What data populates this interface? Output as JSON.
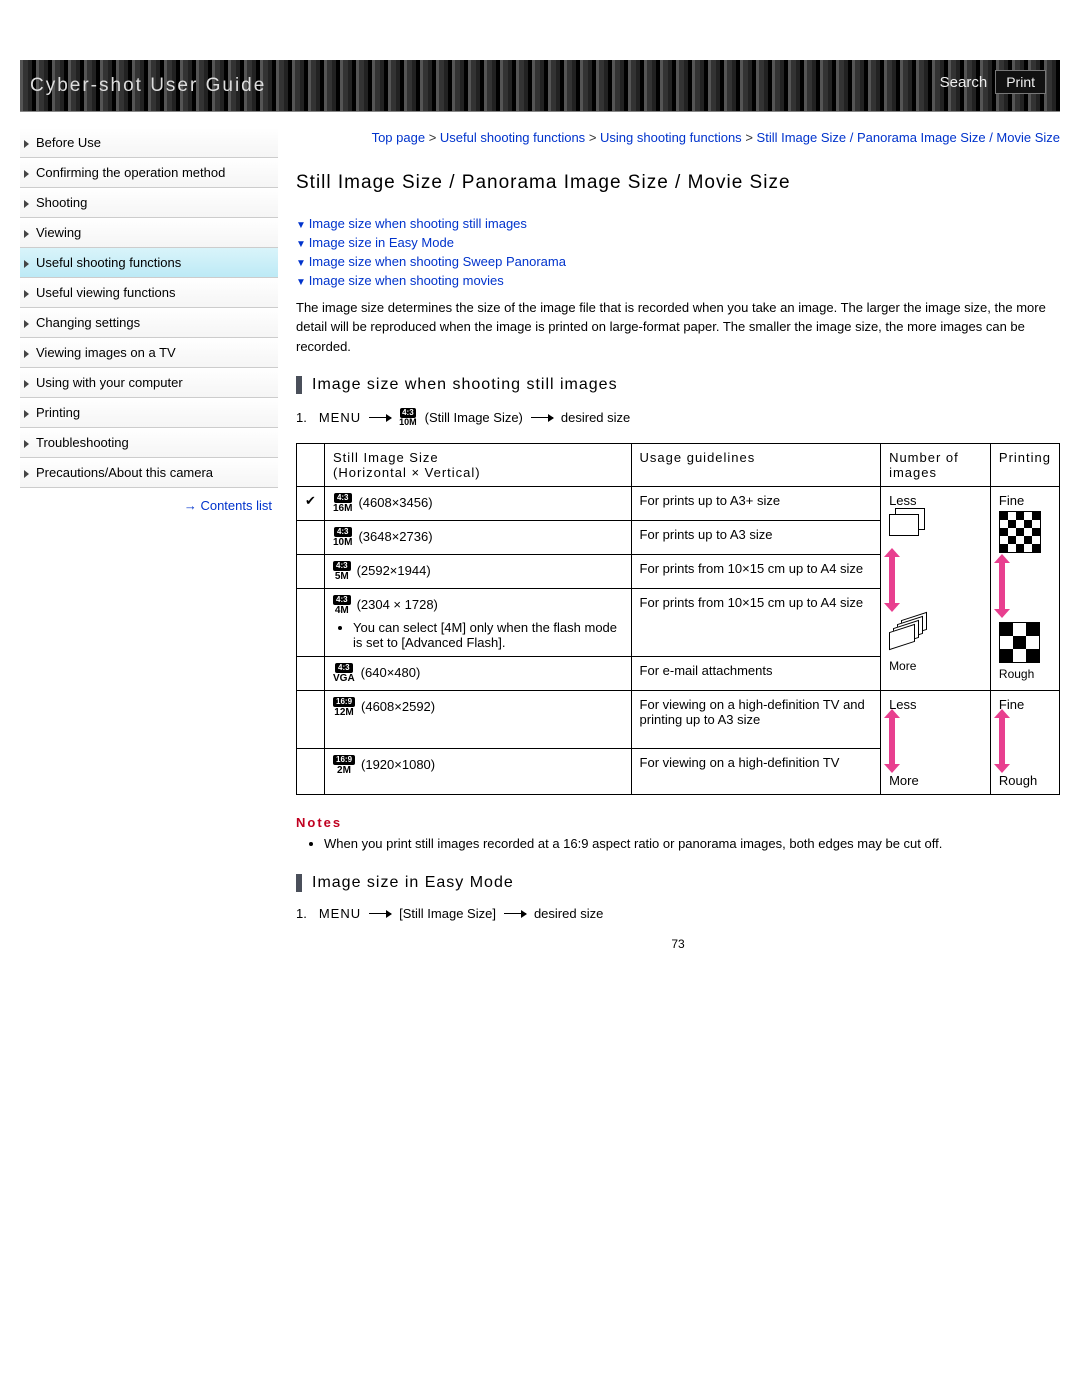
{
  "header": {
    "title": "Cyber-shot User Guide",
    "search": "Search",
    "print": "Print"
  },
  "breadcrumbs": {
    "seg1": "Top page",
    "sep": " > ",
    "seg2": "Useful shooting functions",
    "seg3": "Using shooting functions",
    "seg4": "Still Image Size / Panorama Image Size / Movie Size"
  },
  "sidebar": {
    "items": [
      "Before Use",
      "Confirming the operation method",
      "Shooting",
      "Viewing",
      "Useful shooting functions",
      "Useful viewing functions",
      "Changing settings",
      "Viewing images on a TV",
      "Using with your computer",
      "Printing",
      "Troubleshooting",
      "Precautions/About this camera"
    ],
    "contents": "Contents list"
  },
  "title": "Still Image Size / Panorama Image Size / Movie Size",
  "anchors": [
    "Image size when shooting still images",
    "Image size in Easy Mode",
    "Image size when shooting Sweep Panorama",
    "Image size when shooting movies"
  ],
  "intro": "The image size determines the size of the image file that is recorded when you take an image. The larger the image size, the more detail will be reproduced when the image is printed on large-format paper. The smaller the image size, the more images can be recorded.",
  "sec1": {
    "heading": "Image size when shooting still images",
    "menu": "MENU",
    "badge_ratio": "4:3",
    "badge_mp": "10M",
    "still_label": "(Still Image Size)",
    "desired": "desired size",
    "th1": "Still Image Size",
    "th1b": "(Horizontal × Vertical)",
    "th2": "Usage guidelines",
    "th3": "Number of images",
    "th4": "Printing",
    "rows": [
      {
        "ratio": "4:3",
        "mp": "16M",
        "dims": "(4608×3456)",
        "use": "For prints up to A3+ size",
        "check": "✔"
      },
      {
        "ratio": "4:3",
        "mp": "10M",
        "dims": "(3648×2736)",
        "use": "For prints up to A3 size"
      },
      {
        "ratio": "4:3",
        "mp": "5M",
        "dims": "(2592×1944)",
        "use": "For prints from 10×15 cm up to A4 size"
      },
      {
        "ratio": "4:3",
        "mp": "4M",
        "dims": "(2304 × 1728)",
        "use": "For prints from 10×15 cm up to A4 size",
        "note": "You can select [4M] only when the flash mode is set to [Advanced Flash]."
      },
      {
        "ratio": "4:3",
        "mp": "VGA",
        "dims": "(640×480)",
        "use": "For e-mail attachments"
      },
      {
        "ratio": "16:9",
        "mp": "12M",
        "dims": "(4608×2592)",
        "use": "For viewing on a high-definition TV and printing up to A3 size"
      },
      {
        "ratio": "16:9",
        "mp": "2M",
        "dims": "(1920×1080)",
        "use": "For viewing on a high-definition TV"
      }
    ],
    "less": "Less",
    "more": "More",
    "fine": "Fine",
    "rough": "Rough"
  },
  "notes": {
    "label": "Notes",
    "items": [
      "When you print still images recorded at a 16:9 aspect ratio or panorama images, both edges may be cut off."
    ]
  },
  "sec2": {
    "heading": "Image size in Easy Mode",
    "menu": "MENU",
    "mid": "[Still Image Size]",
    "desired": "desired size"
  },
  "page_number": "73"
}
